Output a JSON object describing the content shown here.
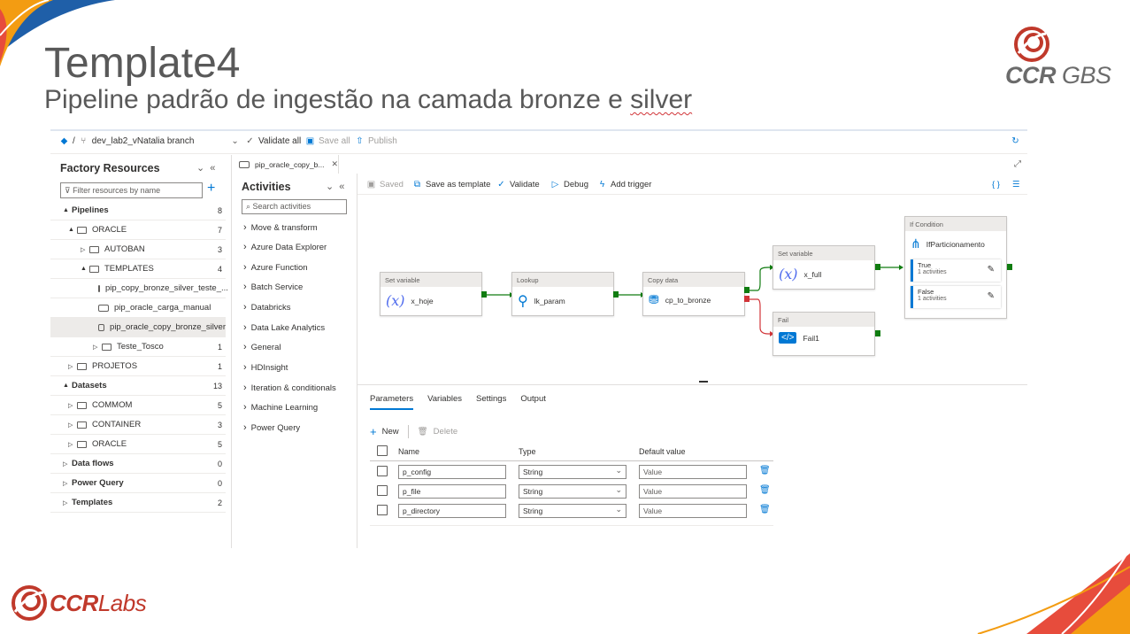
{
  "slide": {
    "title": "Template4",
    "subtitle_pre": "Pipeline padrão de ingestão na camada bronze e ",
    "subtitle_word": "silver"
  },
  "logos": {
    "top_brand": "CCR",
    "top_suffix": "GBS",
    "bottom_brand": "CCR",
    "bottom_suffix": "Labs"
  },
  "topbar": {
    "separator": "/",
    "branch": "dev_lab2_vNatalia branch",
    "validate_all": "Validate all",
    "save_all": "Save all",
    "publish": "Publish"
  },
  "factory": {
    "title": "Factory Resources",
    "filter_placeholder": "Filter resources by name",
    "tree": [
      {
        "label": "Pipelines",
        "count": "8"
      },
      {
        "label": "ORACLE",
        "count": "7"
      },
      {
        "label": "AUTOBAN",
        "count": "3"
      },
      {
        "label": "TEMPLATES",
        "count": "4"
      },
      {
        "label": "pip_copy_bronze_silver_teste_...",
        "count": ""
      },
      {
        "label": "pip_oracle_carga_manual",
        "count": ""
      },
      {
        "label": "pip_oracle_copy_bronze_silver",
        "count": ""
      },
      {
        "label": "Teste_Tosco",
        "count": "1"
      },
      {
        "label": "PROJETOS",
        "count": "1"
      },
      {
        "label": "Datasets",
        "count": "13"
      },
      {
        "label": "COMMOM",
        "count": "5"
      },
      {
        "label": "CONTAINER",
        "count": "3"
      },
      {
        "label": "ORACLE",
        "count": "5"
      },
      {
        "label": "Data flows",
        "count": "0"
      },
      {
        "label": "Power Query",
        "count": "0"
      },
      {
        "label": "Templates",
        "count": "2"
      }
    ]
  },
  "tab": {
    "label": "pip_oracle_copy_b..."
  },
  "activities": {
    "title": "Activities",
    "search_placeholder": "Search activities",
    "categories": [
      "Move & transform",
      "Azure Data Explorer",
      "Azure Function",
      "Batch Service",
      "Databricks",
      "Data Lake Analytics",
      "General",
      "HDInsight",
      "Iteration & conditionals",
      "Machine Learning",
      "Power Query"
    ]
  },
  "canvas_toolbar": {
    "saved": "Saved",
    "save_as_template": "Save as template",
    "validate": "Validate",
    "debug": "Debug",
    "add_trigger": "Add trigger"
  },
  "nodes": {
    "set_hoje": {
      "type": "Set variable",
      "name": "x_hoje"
    },
    "lookup": {
      "type": "Lookup",
      "name": "lk_param"
    },
    "copy": {
      "type": "Copy data",
      "name": "cp_to_bronze"
    },
    "set_full": {
      "type": "Set variable",
      "name": "x_full"
    },
    "fail": {
      "type": "Fail",
      "name": "Fail1"
    },
    "ifcond": {
      "type": "If Condition",
      "name": "IfParticionamento",
      "true_label": "True",
      "true_sub": "1 activities",
      "false_label": "False",
      "false_sub": "1 activities"
    }
  },
  "parameters": {
    "tabs": [
      "Parameters",
      "Variables",
      "Settings",
      "Output"
    ],
    "new": "New",
    "delete": "Delete",
    "headers": {
      "name": "Name",
      "type": "Type",
      "default": "Default value"
    },
    "rows": [
      {
        "name": "p_config",
        "type": "String",
        "default": "Value"
      },
      {
        "name": "p_file",
        "type": "String",
        "default": "Value"
      },
      {
        "name": "p_directory",
        "type": "String",
        "default": "Value"
      }
    ]
  },
  "colors": {
    "accent": "#0078d4",
    "success": "#107c10",
    "fail": "#d13438",
    "brand_red": "#c0392b",
    "title_gray": "#595959"
  }
}
